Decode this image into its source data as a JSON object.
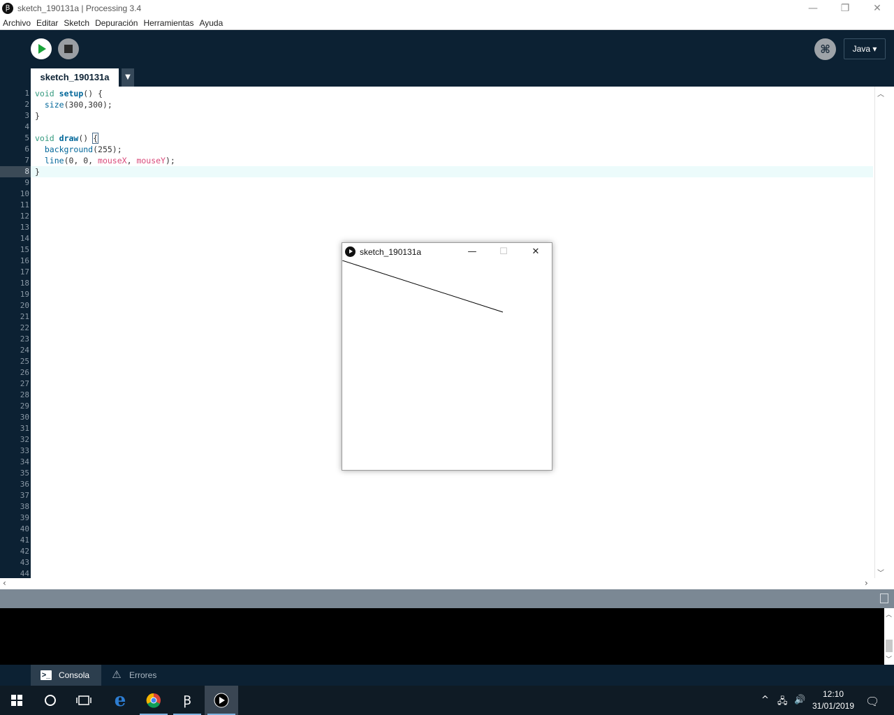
{
  "window": {
    "title": "sketch_190131a | Processing 3.4",
    "app_icon_glyph": "Ꞵ"
  },
  "menu": [
    "Archivo",
    "Editar",
    "Sketch",
    "Depuración",
    "Herramientas",
    "Ayuda"
  ],
  "toolbar": {
    "mode_label": "Java ▾",
    "debug_glyph": "⌘"
  },
  "tab": {
    "name": "sketch_190131a",
    "menu_glyph": "▼"
  },
  "editor": {
    "line_numbers": [
      "1",
      "2",
      "3",
      "4",
      "5",
      "6",
      "7",
      "8",
      "9",
      "10",
      "11",
      "12",
      "13",
      "14",
      "15",
      "16",
      "17",
      "18",
      "19",
      "20",
      "21",
      "22",
      "23",
      "24",
      "25",
      "26",
      "27",
      "28",
      "29",
      "30",
      "31",
      "32",
      "33",
      "34",
      "35",
      "36",
      "37",
      "38",
      "39",
      "40",
      "41",
      "42",
      "43",
      "44"
    ],
    "current_line": 8,
    "code": {
      "l1": {
        "kw": "void",
        "fn": "setup",
        "rest": "() {"
      },
      "l2": {
        "fn": "size",
        "rest": "(300,300);"
      },
      "l3": "}",
      "l5": {
        "kw": "void",
        "fn": "draw",
        "rest": "() ",
        "bracket": "{"
      },
      "l6": {
        "fn": "background",
        "rest": "(255);"
      },
      "l7": {
        "fn": "line",
        "args": "(0, 0, ",
        "var1": "mouseX",
        "sep": ", ",
        "var2": "mouseY",
        "end": ");"
      },
      "l8": "}"
    }
  },
  "footer": {
    "console_tab": "Consola",
    "errors_tab": "Errores"
  },
  "sketch_window": {
    "title": "sketch_190131a",
    "minimize": "—",
    "maximize": "☐",
    "close": "✕"
  },
  "taskbar": {
    "time": "12:10",
    "date": "31/01/2019"
  },
  "colors": {
    "toolbar_bg": "#0c2133",
    "run_green": "#1aa43a",
    "keyword": "#33997e",
    "function": "#006699",
    "variable": "#d94a7a"
  }
}
